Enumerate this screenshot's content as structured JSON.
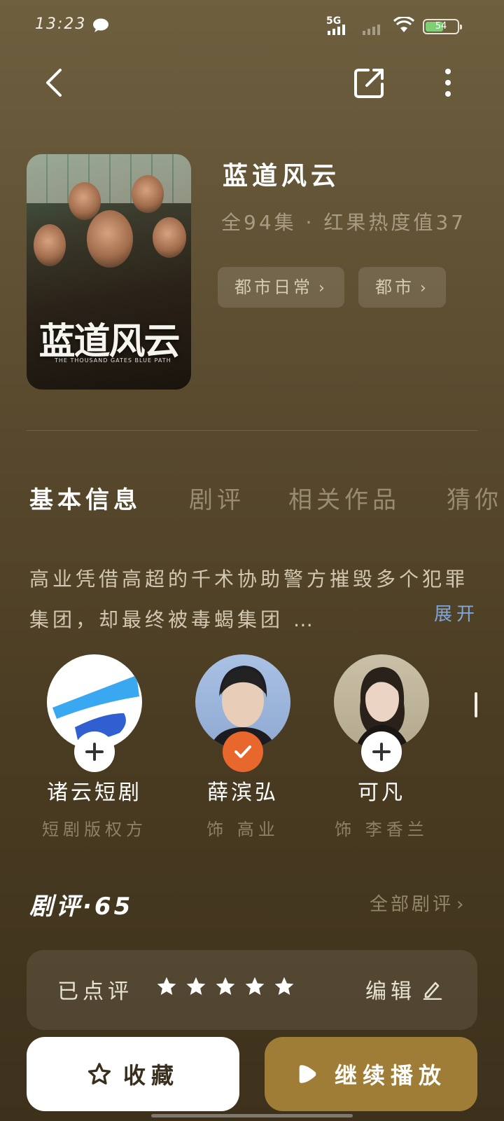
{
  "status_bar": {
    "time": "13:23",
    "network": "5G",
    "battery": "54"
  },
  "header": {
    "back_icon": "back-arrow-icon",
    "share_icon": "share-icon",
    "more_icon": "more-vertical-icon"
  },
  "drama": {
    "title": "蓝道风云",
    "meta": "全94集 · 红果热度值37",
    "poster_title": "蓝道风云",
    "poster_subtitle": "THE THOUSAND GATES BLUE PATH",
    "tags": [
      {
        "label": "都市日常"
      },
      {
        "label": "都市"
      }
    ]
  },
  "tabs": [
    {
      "label": "基本信息",
      "active": true
    },
    {
      "label": "剧评",
      "active": false
    },
    {
      "label": "相关作品",
      "active": false
    },
    {
      "label": "猜你",
      "active": false
    }
  ],
  "description": {
    "text": "高业凭借高超的千术协助警方摧毁多个犯罪集团，却最终被毒蝎集团 …",
    "expand_label": "展开"
  },
  "people": [
    {
      "name": "诸云短剧",
      "role": "短剧版权方",
      "badge": "plus"
    },
    {
      "name": "薛滨弘",
      "role": "饰 高业",
      "badge": "check"
    },
    {
      "name": "可凡",
      "role": "饰 李香兰",
      "badge": "plus"
    }
  ],
  "reviews": {
    "title": "剧评·65",
    "all_label": "全部剧评",
    "rated_label": "已点评",
    "stars": 5,
    "edit_label": "编辑"
  },
  "actions": {
    "favorite_label": "收藏",
    "play_label": "继续播放"
  },
  "colors": {
    "accent_gold": "#9f7d37",
    "expand_blue": "#7fa6d8",
    "check_orange": "#e8672d"
  }
}
